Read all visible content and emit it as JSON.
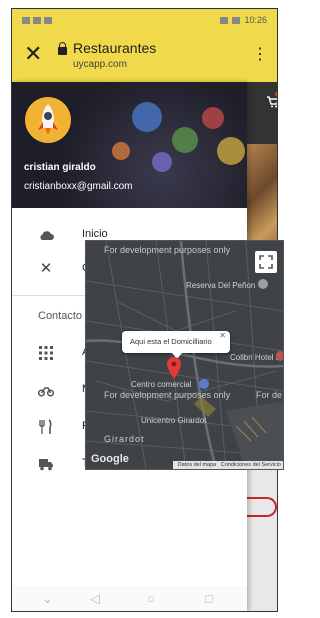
{
  "status_bar": {
    "time": "10:26"
  },
  "browser_bar": {
    "close_icon": "close-icon",
    "title": "Restaurantes",
    "url": "uycapp.com",
    "menu_icon": "more-vert-icon"
  },
  "drawer": {
    "user_name": "cristian giraldo",
    "user_email": "cristianboxx@gmail.com",
    "items": [
      {
        "label": "Inicio",
        "icon": "cloud-icon"
      },
      {
        "label": "C",
        "icon": "close-icon"
      }
    ],
    "section_title": "Contacto",
    "contact_items": [
      {
        "label": "A",
        "icon": "grid-icon"
      },
      {
        "label": "M",
        "icon": "motorcycle-icon"
      },
      {
        "label": "R",
        "icon": "restaurant-icon"
      },
      {
        "label": "T",
        "icon": "delivery-truck-icon"
      }
    ]
  },
  "map": {
    "dev_notice_top": "For development purposes only",
    "dev_notice_mid": "For development purposes only",
    "dev_notice_right": "For de",
    "info_window": "Aqui esta el Domicilliario",
    "places": {
      "reserva": "Reserva Del Peñon",
      "colibri": "Colibri Hotel El Peñon",
      "centro": "Centro comercial",
      "centro2": "Unicentro Girardot",
      "girardot": "Girardot"
    },
    "google_logo": "Google",
    "credit_data": "Datos del mapa",
    "credit_terms": "Condiciones del Servicio"
  },
  "colors": {
    "app_bar": "#f0d94a",
    "avatar_bg": "#f2b233",
    "map_bg": "#3f4347",
    "marker": "#e53935"
  }
}
